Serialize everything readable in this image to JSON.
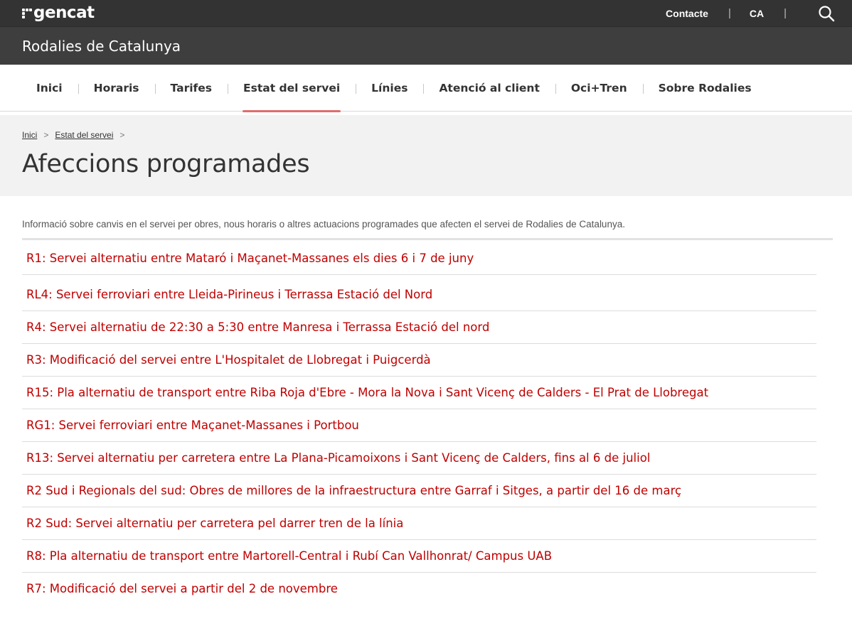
{
  "topbar": {
    "logo_text": "gencat",
    "contact_label": "Contacte",
    "separator": "|",
    "language": "CA"
  },
  "subheader": {
    "site_title": "Rodalies de Catalunya"
  },
  "nav": {
    "items": [
      {
        "label": "Inici"
      },
      {
        "label": "Horaris"
      },
      {
        "label": "Tarifes"
      },
      {
        "label": "Estat del servei"
      },
      {
        "label": "Línies"
      },
      {
        "label": "Atenció al client"
      },
      {
        "label": "Oci+Tren"
      },
      {
        "label": "Sobre Rodalies"
      }
    ],
    "active": "Estat del servei"
  },
  "breadcrumb": {
    "items": [
      "Inici",
      "Estat del servei"
    ],
    "separator": ">"
  },
  "page": {
    "title": "Afeccions programades",
    "intro": "Informació sobre canvis en el servei per obres, nous horaris o altres actuacions programades que afecten el servei de Rodalies de Catalunya."
  },
  "notices": [
    "R1: Servei alternatiu entre Mataró i Maçanet-Massanes els dies 6 i 7 de juny",
    "RL4: Servei ferroviari entre Lleida-Pirineus i Terrassa Estació del Nord",
    "R4: Servei alternatiu de 22:30 a 5:30 entre Manresa i Terrassa Estació del nord",
    "R3: Modificació del servei entre L'Hospitalet de Llobregat i Puigcerdà",
    "R15: Pla alternatiu de transport entre Riba Roja d'Ebre - Mora la Nova i Sant Vicenç de Calders - El Prat de Llobregat",
    "RG1: Servei ferroviari entre Maçanet-Massanes i Portbou",
    "R13: Servei alternatiu per carretera entre La Plana-Picamoixons i Sant Vicenç de Calders, fins al 6 de juliol",
    "R2 Sud i Regionals del sud: Obres de millores de la infraestructura entre Garraf i Sitges, a partir del 16 de març",
    "R2 Sud: Servei alternatiu per carretera pel darrer tren de la línia",
    "R8: Pla alternatiu de transport entre Martorell-Central i Rubí Can Vallhonrat/ Campus UAB",
    "R7: Modificació del servei a partir del 2 de novembre"
  ],
  "colors": {
    "topbar": "#333333",
    "subheader": "#3e3e3e",
    "link": "#c00000",
    "active_underline": "#e06c6c",
    "hero_bg": "#f2f2f2"
  }
}
